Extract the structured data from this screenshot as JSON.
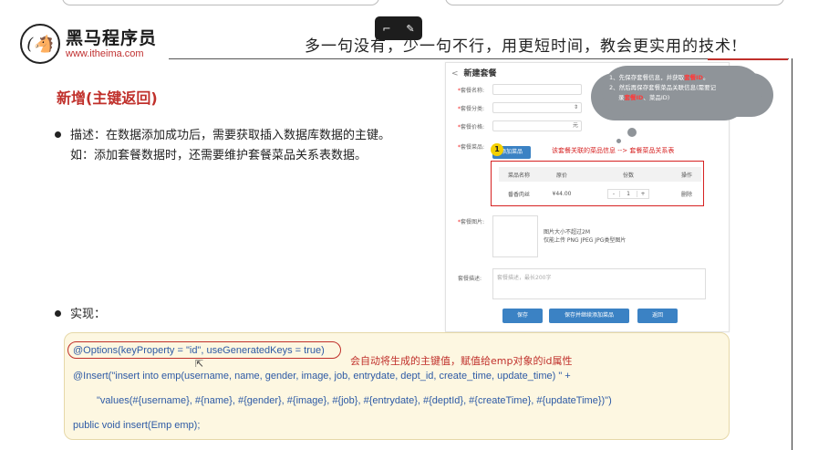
{
  "header": {
    "logo_mark": "(🐴",
    "logo_name": "黑马程序员",
    "logo_url": "www.itheima.com",
    "slogan": "多一句没有，少一句不行，用更短时间，教会更实用的技术!"
  },
  "float_toolbar": {
    "icon1": "⌐",
    "icon2": "✎"
  },
  "section_title": "新增(主键返回)",
  "bullets": {
    "desc_line1": "描述：在数据添加成功后，需要获取插入数据库数据的主键。",
    "desc_line2": "如：添加套餐数据时，还需要维护套餐菜品关系表数据。",
    "impl": "实现："
  },
  "form": {
    "title": "新建套餐",
    "back": "<",
    "name_label": "套餐名称:",
    "category_label": "套餐分类:",
    "price_label": "套餐价格:",
    "price_unit": "元",
    "dishes_label": "套餐菜品:",
    "add_dish_button": "添加菜品",
    "step_number": "1",
    "annotation": "该套餐关联的菜品信息 --> 套餐菜品关系表",
    "table_headers": [
      "菜品名称",
      "原价",
      "份数",
      "操作"
    ],
    "table_row": {
      "name": "番香肉丝",
      "price": "¥44.00",
      "minus": "-",
      "qty": "1",
      "plus": "+",
      "action": "删除"
    },
    "image_label": "套餐图片:",
    "image_hint_1": "图片大小不超过2M",
    "image_hint_2": "仅能上传 PNG JPEG JPG类型图片",
    "desc_label": "套餐描述:",
    "desc_placeholder": "套餐描述，最长200字",
    "save_button": "保存",
    "save_continue_button": "保存并继续添加菜品",
    "back_button": "返回"
  },
  "cloud": {
    "line1_pre": "1、先保存套餐信息，并获取",
    "line1_hl": "套餐ID",
    "line1_post": "。",
    "line2": "2、然后再保存套餐菜品关联信息(需要记",
    "line3_pre": "录",
    "line3_hl": "套餐ID",
    "line3_post": "、菜品ID)"
  },
  "code": {
    "line1": "@Options(keyProperty = \"id\", useGeneratedKeys = true)",
    "note": "会自动将生成的主键值，赋值给emp对象的id属性",
    "line2": "@Insert(\"insert into emp(username, name, gender, image, job, entrydate, dept_id, create_time, update_time) \" +",
    "line3": "\"values(#{username}, #{name}, #{gender}, #{image}, #{job}, #{entrydate}, #{deptId}, #{createTime}, #{updateTime})\")",
    "line4": "public void insert(Emp emp);"
  }
}
